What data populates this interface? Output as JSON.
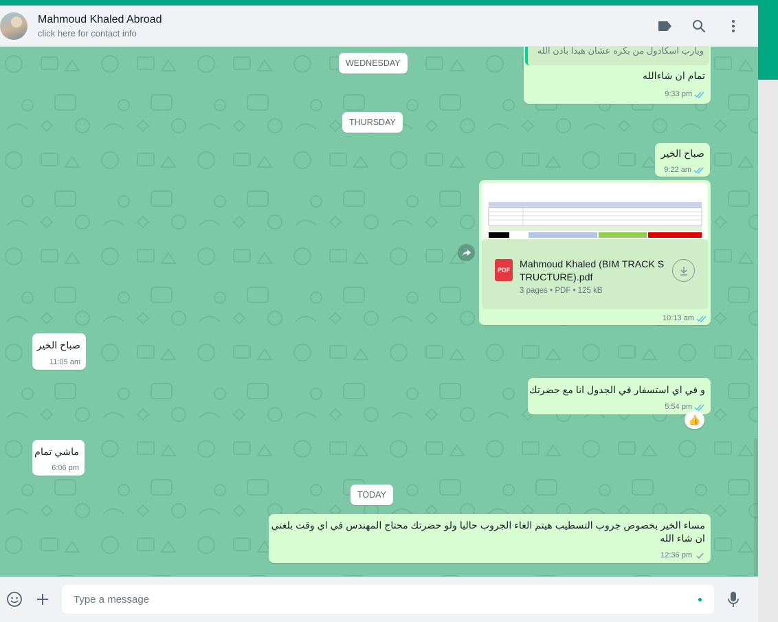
{
  "header": {
    "contact_name": "Mahmoud Khaled Abroad",
    "contact_sub": "click here for contact info",
    "icons": [
      "label-icon",
      "search-icon",
      "menu-icon"
    ]
  },
  "colors": {
    "accent": "#00a884",
    "chat_bg": "#7dc8a6",
    "outgoing_bubble": "#d9fdd3",
    "incoming_bubble": "#ffffff",
    "read_tick": "#53bdeb"
  },
  "dates": {
    "wednesday": "WEDNESDAY",
    "thursday": "THURSDAY",
    "today": "TODAY"
  },
  "messages": {
    "m1": {
      "quote": "ويارب اسكادول من بكره عشان هبدا باذن الله",
      "text": "تمام ان شاءالله",
      "time": "9:33 pm",
      "status": "read"
    },
    "m2": {
      "text": "صباح الخير",
      "time": "9:22 am",
      "status": "read"
    },
    "m3": {
      "file_name": "Mahmoud Khaled (BIM TRACK STRUCTURE).pdf",
      "file_info": "3 pages • PDF • 125 kB",
      "file_type": "PDF",
      "time": "10:13 am",
      "status": "read"
    },
    "m4": {
      "text": "صباح الخير",
      "time": "11:05 am"
    },
    "m5": {
      "text": "و في اي استسفار في الجدول انا مع حضرتك",
      "time": "5:54 pm",
      "status": "read",
      "reaction": "👍"
    },
    "m6": {
      "text": "ماشي تمام",
      "time": "6:06 pm"
    },
    "m7": {
      "line1": "مساء الخير بخصوص جروب التسطيب هيتم الغاء الجروب حاليا ولو حضرتك محتاج المهندس في اي وقت بلغني",
      "line2": "ان شاء الله",
      "time": "12:36 pm",
      "status": "sent"
    }
  },
  "composer": {
    "placeholder": "Type a message",
    "icons": [
      "emoji-icon",
      "attach-icon",
      "mic-icon"
    ]
  }
}
